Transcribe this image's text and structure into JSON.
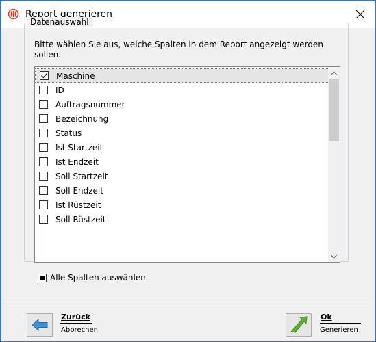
{
  "window": {
    "title": "Report generieren"
  },
  "group": {
    "legend": "Datenauswahl",
    "instructions": "Bitte wählen Sie aus, welche Spalten in dem Report angezeigt werden sollen."
  },
  "columns": {
    "items": [
      {
        "label": "Maschine",
        "checked": true,
        "selected": true
      },
      {
        "label": "ID",
        "checked": false
      },
      {
        "label": "Auftragsnummer",
        "checked": false
      },
      {
        "label": "Bezeichnung",
        "checked": false
      },
      {
        "label": "Status",
        "checked": false
      },
      {
        "label": "Ist Startzeit",
        "checked": false
      },
      {
        "label": "Ist Endzeit",
        "checked": false
      },
      {
        "label": "Soll Startzeit",
        "checked": false
      },
      {
        "label": "Soll Endzeit",
        "checked": false
      },
      {
        "label": "Ist Rüstzeit",
        "checked": false
      },
      {
        "label": "Soll Rüstzeit",
        "checked": false
      }
    ]
  },
  "select_all": {
    "label": "Alle Spalten auswählen",
    "state": "indeterminate"
  },
  "footer": {
    "back": {
      "main": "Zurück",
      "sub": "Abbrechen"
    },
    "ok": {
      "main": "Ok",
      "sub": "Generieren"
    }
  },
  "colors": {
    "window_border": "#2b78c5",
    "app_icon": "#e03c2a",
    "back_arrow": "#3d8fd8",
    "ok_check": "#63b030"
  }
}
